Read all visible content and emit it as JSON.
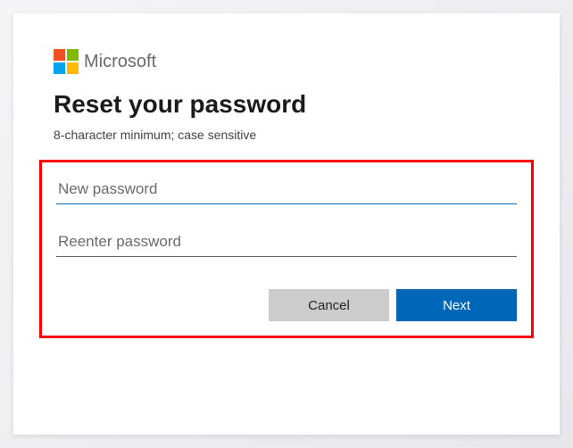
{
  "brand": {
    "name": "Microsoft"
  },
  "header": {
    "title": "Reset your password",
    "subtitle": "8-character minimum; case sensitive"
  },
  "form": {
    "new_password": {
      "placeholder": "New password",
      "value": ""
    },
    "reenter_password": {
      "placeholder": "Reenter password",
      "value": ""
    }
  },
  "buttons": {
    "cancel": "Cancel",
    "next": "Next"
  },
  "colors": {
    "primary": "#0067b8",
    "highlight": "#ff0000"
  }
}
